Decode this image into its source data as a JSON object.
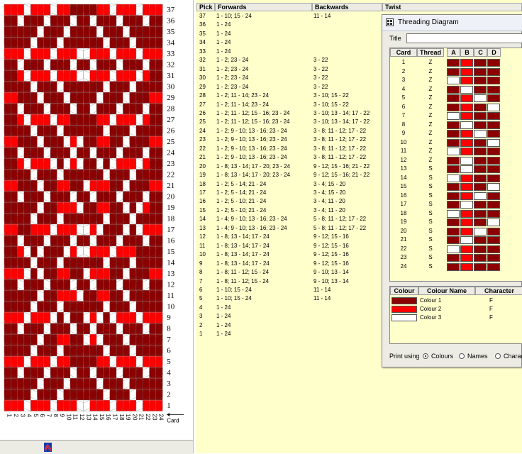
{
  "colors": {
    "colour_1": "#8b0000",
    "colour_2": "#ff0000",
    "colour_3": "#ffffff",
    "grid_background": "#ffffff",
    "list_background": "#ffffcc"
  },
  "chart_data": {
    "type": "heatmap",
    "title": "",
    "xlabel": "Card",
    "ylabel": "",
    "x_ticks": [
      "1",
      "2",
      "3",
      "4",
      "5",
      "6",
      "7",
      "8",
      "9",
      "10",
      "11",
      "12",
      "13",
      "14",
      "15",
      "16",
      "17",
      "18",
      "19",
      "20",
      "21",
      "22",
      "23",
      "24"
    ],
    "y_ticks": [
      "1",
      "2",
      "3",
      "4",
      "5",
      "6",
      "7",
      "8",
      "9",
      "10",
      "11",
      "12",
      "13",
      "14",
      "15",
      "16",
      "17",
      "18",
      "19",
      "20",
      "21",
      "22",
      "23",
      "24",
      "25",
      "26",
      "27",
      "28",
      "29",
      "30",
      "31",
      "32",
      "33",
      "34",
      "35",
      "36",
      "37"
    ],
    "series_colors": [
      "#8b0000",
      "#ff0000",
      "#ffffff"
    ]
  },
  "columns": {
    "pick": "Pick",
    "forwards": "Forwards",
    "backwards": "Backwards",
    "twist": "Twist"
  },
  "picks": [
    {
      "pick": "37",
      "forwards": "1 - 10; 15 - 24",
      "backwards": "11 - 14"
    },
    {
      "pick": "36",
      "forwards": "1 - 24",
      "backwards": ""
    },
    {
      "pick": "35",
      "forwards": "1 - 24",
      "backwards": ""
    },
    {
      "pick": "34",
      "forwards": "1 - 24",
      "backwards": ""
    },
    {
      "pick": "33",
      "forwards": "1 - 24",
      "backwards": ""
    },
    {
      "pick": "32",
      "forwards": "1 - 2; 23 - 24",
      "backwards": "3 - 22"
    },
    {
      "pick": "31",
      "forwards": "1 - 2; 23 - 24",
      "backwards": "3 - 22"
    },
    {
      "pick": "30",
      "forwards": "1 - 2; 23 - 24",
      "backwards": "3 - 22"
    },
    {
      "pick": "29",
      "forwards": "1 - 2; 23 - 24",
      "backwards": "3 - 22"
    },
    {
      "pick": "28",
      "forwards": "1 - 2; 11 - 14; 23 - 24",
      "backwards": "3 - 10; 15 - 22"
    },
    {
      "pick": "27",
      "forwards": "1 - 2; 11 - 14; 23 - 24",
      "backwards": "3 - 10; 15 - 22"
    },
    {
      "pick": "26",
      "forwards": "1 - 2; 11 - 12; 15 - 16; 23 - 24",
      "backwards": "3 - 10; 13 - 14; 17 - 22"
    },
    {
      "pick": "25",
      "forwards": "1 - 2; 11 - 12; 15 - 16; 23 - 24",
      "backwards": "3 - 10; 13 - 14; 17 - 22"
    },
    {
      "pick": "24",
      "forwards": "1 - 2; 9 - 10; 13 - 16; 23 - 24",
      "backwards": "3 - 8; 11 - 12; 17 - 22"
    },
    {
      "pick": "23",
      "forwards": "1 - 2; 9 - 10; 13 - 16; 23 - 24",
      "backwards": "3 - 8; 11 - 12; 17 - 22"
    },
    {
      "pick": "22",
      "forwards": "1 - 2; 9 - 10; 13 - 16; 23 - 24",
      "backwards": "3 - 8; 11 - 12; 17 - 22"
    },
    {
      "pick": "21",
      "forwards": "1 - 2; 9 - 10; 13 - 16; 23 - 24",
      "backwards": "3 - 8; 11 - 12; 17 - 22"
    },
    {
      "pick": "20",
      "forwards": "1 - 8; 13 - 14; 17 - 20; 23 - 24",
      "backwards": "9 - 12; 15 - 16; 21 - 22"
    },
    {
      "pick": "19",
      "forwards": "1 - 8; 13 - 14; 17 - 20; 23 - 24",
      "backwards": "9 - 12; 15 - 16; 21 - 22"
    },
    {
      "pick": "18",
      "forwards": "1 - 2; 5 - 14; 21 - 24",
      "backwards": "3 - 4; 15 - 20"
    },
    {
      "pick": "17",
      "forwards": "1 - 2; 5 - 14; 21 - 24",
      "backwards": "3 - 4; 15 - 20"
    },
    {
      "pick": "16",
      "forwards": "1 - 2; 5 - 10; 21 - 24",
      "backwards": "3 - 4; 11 - 20"
    },
    {
      "pick": "15",
      "forwards": "1 - 2; 5 - 10; 21 - 24",
      "backwards": "3 - 4; 11 - 20"
    },
    {
      "pick": "14",
      "forwards": "1 - 4; 9 - 10; 13 - 16; 23 - 24",
      "backwards": "5 - 8; 11 - 12; 17 - 22"
    },
    {
      "pick": "13",
      "forwards": "1 - 4; 9 - 10; 13 - 16; 23 - 24",
      "backwards": "5 - 8; 11 - 12; 17 - 22"
    },
    {
      "pick": "12",
      "forwards": "1 - 8; 13 - 14; 17 - 24",
      "backwards": "9 - 12; 15 - 16"
    },
    {
      "pick": "11",
      "forwards": "1 - 8; 13 - 14; 17 - 24",
      "backwards": "9 - 12; 15 - 16"
    },
    {
      "pick": "10",
      "forwards": "1 - 8; 13 - 14; 17 - 24",
      "backwards": "9 - 12; 15 - 16"
    },
    {
      "pick": "9",
      "forwards": "1 - 8; 13 - 14; 17 - 24",
      "backwards": "9 - 12; 15 - 16"
    },
    {
      "pick": "8",
      "forwards": "1 - 8; 11 - 12; 15 - 24",
      "backwards": "9 - 10; 13 - 14"
    },
    {
      "pick": "7",
      "forwards": "1 - 8; 11 - 12; 15 - 24",
      "backwards": "9 - 10; 13 - 14"
    },
    {
      "pick": "6",
      "forwards": "1 - 10; 15 - 24",
      "backwards": "11 - 14"
    },
    {
      "pick": "5",
      "forwards": "1 - 10; 15 - 24",
      "backwards": "11 - 14"
    },
    {
      "pick": "4",
      "forwards": "1 - 24",
      "backwards": ""
    },
    {
      "pick": "3",
      "forwards": "1 - 24",
      "backwards": ""
    },
    {
      "pick": "2",
      "forwards": "1 - 24",
      "backwards": ""
    },
    {
      "pick": "1",
      "forwards": "1 - 24",
      "backwards": ""
    }
  ],
  "dialog": {
    "title": "Threading Diagram",
    "title_label": "Title",
    "title_value": "",
    "columns": {
      "card": "Card",
      "thread": "Thread",
      "a": "A",
      "b": "B",
      "c": "C",
      "d": "D"
    },
    "cards": [
      {
        "card": "1",
        "thread": "Z",
        "holes": [
          1,
          2,
          1,
          1
        ]
      },
      {
        "card": "2",
        "thread": "Z",
        "holes": [
          1,
          2,
          1,
          1
        ]
      },
      {
        "card": "3",
        "thread": "Z",
        "holes": [
          3,
          2,
          1,
          1
        ]
      },
      {
        "card": "4",
        "thread": "Z",
        "holes": [
          1,
          3,
          1,
          1
        ]
      },
      {
        "card": "5",
        "thread": "Z",
        "holes": [
          1,
          2,
          3,
          1
        ]
      },
      {
        "card": "6",
        "thread": "Z",
        "holes": [
          1,
          2,
          1,
          3
        ]
      },
      {
        "card": "7",
        "thread": "Z",
        "holes": [
          3,
          2,
          1,
          1
        ]
      },
      {
        "card": "8",
        "thread": "Z",
        "holes": [
          1,
          3,
          1,
          1
        ]
      },
      {
        "card": "9",
        "thread": "Z",
        "holes": [
          1,
          2,
          3,
          1
        ]
      },
      {
        "card": "10",
        "thread": "Z",
        "holes": [
          1,
          2,
          1,
          3
        ]
      },
      {
        "card": "11",
        "thread": "Z",
        "holes": [
          3,
          2,
          1,
          1
        ]
      },
      {
        "card": "12",
        "thread": "Z",
        "holes": [
          1,
          3,
          1,
          1
        ]
      },
      {
        "card": "13",
        "thread": "S",
        "holes": [
          1,
          3,
          1,
          1
        ]
      },
      {
        "card": "14",
        "thread": "S",
        "holes": [
          3,
          2,
          1,
          1
        ]
      },
      {
        "card": "15",
        "thread": "S",
        "holes": [
          1,
          2,
          1,
          3
        ]
      },
      {
        "card": "16",
        "thread": "S",
        "holes": [
          1,
          2,
          3,
          1
        ]
      },
      {
        "card": "17",
        "thread": "S",
        "holes": [
          1,
          3,
          1,
          1
        ]
      },
      {
        "card": "18",
        "thread": "S",
        "holes": [
          3,
          2,
          1,
          1
        ]
      },
      {
        "card": "19",
        "thread": "S",
        "holes": [
          1,
          2,
          1,
          3
        ]
      },
      {
        "card": "20",
        "thread": "S",
        "holes": [
          1,
          2,
          3,
          1
        ]
      },
      {
        "card": "21",
        "thread": "S",
        "holes": [
          1,
          3,
          1,
          1
        ]
      },
      {
        "card": "22",
        "thread": "S",
        "holes": [
          3,
          2,
          1,
          1
        ]
      },
      {
        "card": "23",
        "thread": "S",
        "holes": [
          1,
          2,
          1,
          1
        ]
      },
      {
        "card": "24",
        "thread": "S",
        "holes": [
          1,
          2,
          1,
          1
        ]
      }
    ],
    "colour_columns": {
      "colour": "Colour",
      "name": "Colour Name",
      "character": "Character"
    },
    "colours": [
      {
        "swatch": "#8b0000",
        "name": "Colour 1",
        "character": "F"
      },
      {
        "swatch": "#ff0000",
        "name": "Colour 2",
        "character": "F"
      },
      {
        "swatch": "#ffffff",
        "name": "Colour 3",
        "character": "F"
      }
    ],
    "print_using_label": "Print using",
    "print_options": [
      {
        "label": "Colours",
        "selected": true
      },
      {
        "label": "Names",
        "selected": false
      },
      {
        "label": "Characters",
        "selected": false
      }
    ]
  }
}
